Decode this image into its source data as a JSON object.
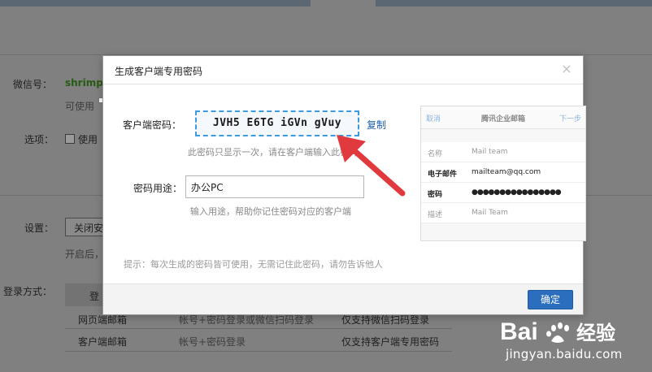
{
  "background": {
    "wechat_label": "微信号：",
    "wechat_value": "shrimp",
    "wechat_note": "可使用",
    "options_label": "选项：",
    "options_check": "使用",
    "settings_label": "设置：",
    "settings_select": "关闭安",
    "settings_note": "开启后，",
    "login_label": "登录方式：",
    "table_header": "登",
    "rows": [
      {
        "type": "网页端邮箱",
        "method": "帐号+密码登录或微信扫码登录",
        "note": "仅支持微信扫码登录"
      },
      {
        "type": "客户端邮箱",
        "method": "帐号+密码登录",
        "note": "仅支持客户端专用密码"
      }
    ]
  },
  "modal": {
    "title": "生成客户端专用密码",
    "close_icon": "×",
    "password_label": "客户端密码：",
    "password_value": "JVH5 E6TG iGVn gVuy",
    "copy_label": "复制",
    "password_hint": "此密码只显示一次，请在客户端输入此密码",
    "purpose_label": "密码用途：",
    "purpose_value": "办公PC",
    "purpose_hint": "输入用途，帮助你记住密码对应的客户端",
    "tip": "提示：每次生成的密码皆可使用，无需记住此密码，请勿告诉他人",
    "ok_label": "确定",
    "preview": {
      "cancel": "取消",
      "title": "腾讯企业邮箱",
      "next": "下一步",
      "rows": [
        {
          "key": "名称",
          "value": "Mail team",
          "dark": false
        },
        {
          "key": "电子邮件",
          "value": "mailteam@qq.com",
          "dark": true
        },
        {
          "key": "密码",
          "value": "●●●●●●●●●●●●●●●●",
          "dark": true
        },
        {
          "key": "描述",
          "value": "Mail Team",
          "dark": false
        }
      ]
    }
  },
  "watermark": {
    "brand": "Bai",
    "brand_cn": "经验",
    "url": "jingyan.baidu.com"
  },
  "colors": {
    "accent_blue": "#2a6ebd",
    "dashed_border": "#3d9be0",
    "arrow_red": "#e0393e"
  }
}
